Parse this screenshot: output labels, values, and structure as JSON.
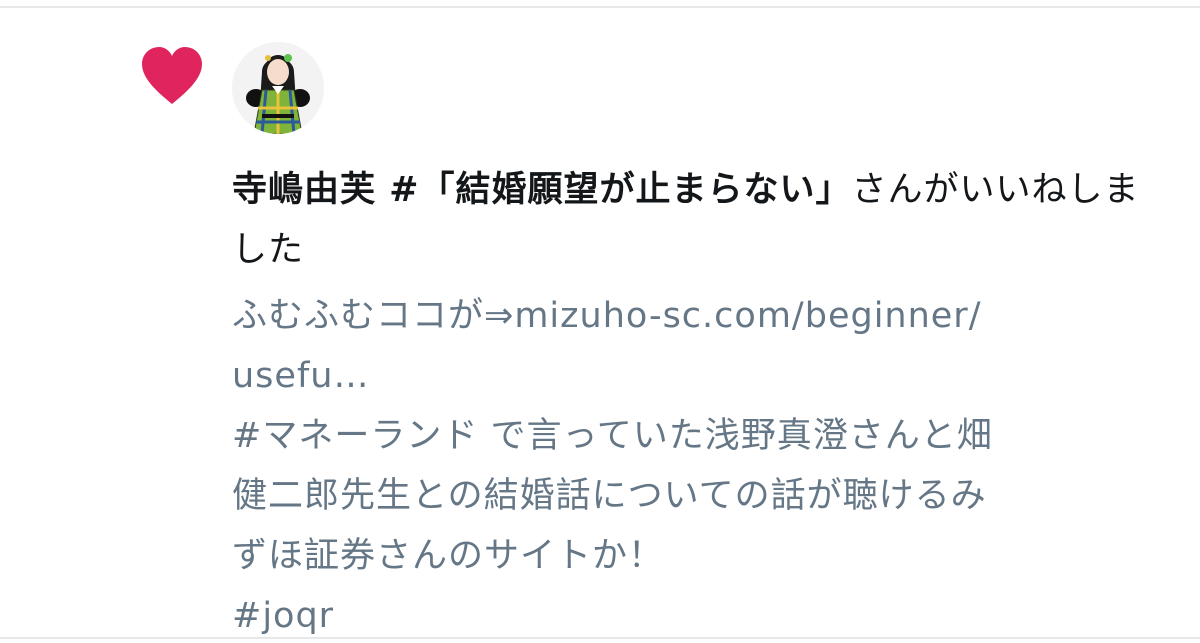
{
  "notification": {
    "type_icon": "heart-icon",
    "accent_color": "#e0245e",
    "avatar": "user-avatar",
    "user_name": "寺嶋由芙 #「結婚願望が止まらない」",
    "action_text": "さんがいいねしました"
  },
  "tweet": {
    "line1": "ふむふむココが⇒mizuho-sc.com/beginner/",
    "line2": "usefu…",
    "line3": "#マネーランド で言っていた浅野真澄さんと畑",
    "line4": "健二郎先生との結婚話についての話が聴けるみ",
    "line5": "ずほ証券さんのサイトか！",
    "line6": "#joqr"
  }
}
